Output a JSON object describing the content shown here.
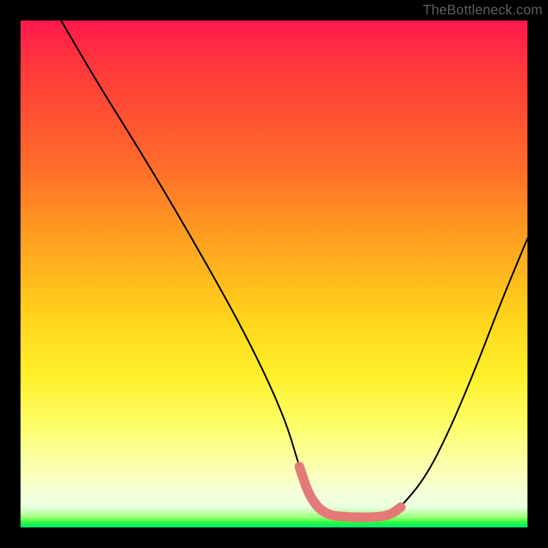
{
  "watermark": "TheBottleneck.com",
  "chart_data": {
    "type": "line",
    "title": "",
    "xlabel": "",
    "ylabel": "",
    "xlim": [
      0,
      100
    ],
    "ylim": [
      0,
      100
    ],
    "series": [
      {
        "name": "black-curve",
        "color": "#000000",
        "x": [
          8,
          15,
          25,
          35,
          45,
          52,
          55,
          57,
          60,
          65,
          70,
          73,
          75,
          80,
          85,
          90,
          95,
          100
        ],
        "y": [
          100,
          88,
          72,
          55,
          37,
          22,
          12,
          6,
          2.5,
          2,
          2,
          2.5,
          4,
          10,
          20,
          32,
          45,
          57
        ]
      },
      {
        "name": "highlight-segment",
        "color": "#e47a78",
        "x": [
          55,
          57,
          60,
          65,
          70,
          73,
          75
        ],
        "y": [
          12,
          6,
          2.5,
          2,
          2,
          2.5,
          4
        ]
      }
    ],
    "background_gradient": {
      "top": "#ff1a4d",
      "mid_upper": "#ffa61f",
      "mid": "#fff02a",
      "mid_lower": "#fbffae",
      "bottom": "#00e676"
    }
  }
}
